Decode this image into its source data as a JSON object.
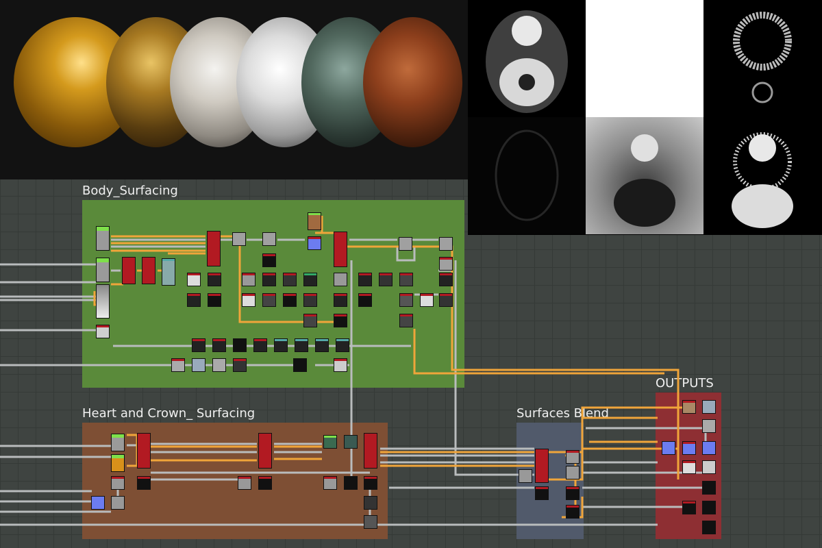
{
  "frames": {
    "body_surfacing": {
      "title": "Body_Surfacing",
      "color": "#5a8a3a"
    },
    "heart_crown": {
      "title": "Heart and Crown_ Surfacing",
      "color": "#7e4f34"
    },
    "surfaces_blend": {
      "title": "Surfaces Blend",
      "color": "#515a6b"
    },
    "outputs": {
      "title": "OUTPUTS",
      "color": "#8e2f33"
    }
  },
  "preview": {
    "materials": [
      "gold",
      "dark-gold",
      "white-marble",
      "light-marble",
      "green-stone",
      "rusted-metal"
    ],
    "maps": [
      "base-color-map",
      "opacity-map",
      "height-map",
      "ambient-occlusion-map",
      "roughness-map",
      "normal-map"
    ]
  },
  "colors": {
    "wire_orange": "#f0a53a",
    "wire_gray": "#b9bcbd",
    "node_red": "#b21a22",
    "node_green": "#7ee04a",
    "node_blue": "#6c7cf0"
  }
}
